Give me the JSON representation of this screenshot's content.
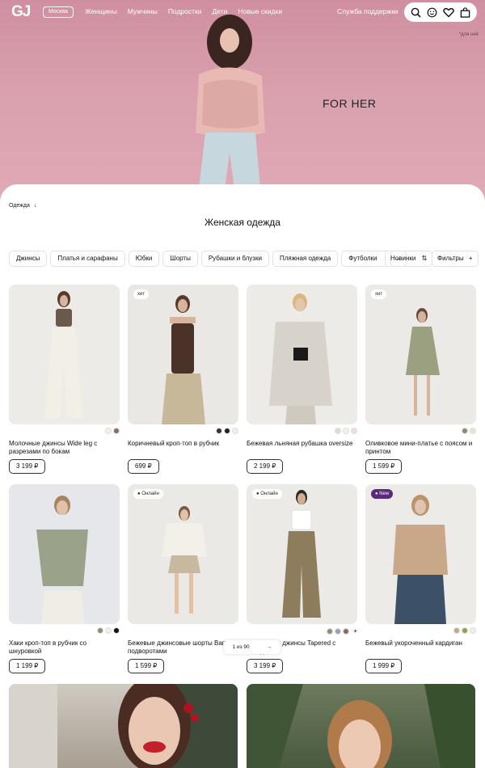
{
  "brand": {
    "logo": "GJ",
    "city": "Москва"
  },
  "nav": {
    "items": [
      "Женщины",
      "Мужчины",
      "Подростки",
      "Дети",
      "Новые скидки"
    ],
    "support": "Служба поддержки"
  },
  "icons": [
    "search-icon",
    "smiley-icon",
    "heart-icon",
    "bag-icon"
  ],
  "hero": {
    "title": "FOR HER",
    "note": "*для неё"
  },
  "breadcrumb": {
    "label": "Одежда",
    "arrow": "↓"
  },
  "page": {
    "title": "Женская одежда"
  },
  "categories": [
    "Джинсы",
    "Платья и сарафаны",
    "Юбки",
    "Шорты",
    "Рубашки и блузки",
    "Пляжная одежда",
    "Футболки"
  ],
  "categories_more": "→",
  "sort": {
    "label": "Новинки",
    "icon": "⇅"
  },
  "filters": {
    "label": "Фильтры",
    "icon": "+"
  },
  "products": [
    {
      "name": "Молочные джинсы Wide leg с разрезами по бокам",
      "price": "3 199 ₽",
      "badge": "",
      "swatches": [
        "#f2f0ea",
        "#8b6c5c"
      ]
    },
    {
      "name": "Коричневый кроп-топ в рубчик",
      "price": "699 ₽",
      "badge": "хит",
      "swatches": [
        "#4a2d28",
        "#222222",
        "#eeeeee"
      ]
    },
    {
      "name": "Бежевая льняная рубашка oversize",
      "price": "2 199 ₽",
      "badge": "",
      "swatches": [
        "#dedcd6",
        "#f4f1ea",
        "#f1d9dc"
      ]
    },
    {
      "name": "Оливковое мини-платье с поясом и принтом",
      "price": "1 599 ₽",
      "badge": "хит",
      "swatches": [
        "#8c8d6e",
        "#e4e2dc"
      ]
    },
    {
      "name": "Хаки кроп-топ в рубчик со шнуровкой",
      "price": "1 199 ₽",
      "badge": "",
      "swatches": [
        "#8a8f72",
        "#f3f1ec",
        "#111111"
      ]
    },
    {
      "name": "Бежевые джинсовые шорты Вагги с подворотами",
      "price": "1 599 ₽",
      "badge": "● Онлайн",
      "swatches": []
    },
    {
      "name": "Оливковые джинсы Tapered с посадкой",
      "price": "3 199 ₽",
      "badge": "● Онлайн",
      "swatches": [
        "#8a8f72",
        "#9aa3a8",
        "#8b6c5c"
      ],
      "more": "+"
    },
    {
      "name": "Бежевый укороченный кардиган",
      "price": "1 999 ₽",
      "badge": "● New",
      "swatches": [
        "#c9a38c",
        "#8fa14a",
        "#eeeeee"
      ]
    }
  ],
  "pager": {
    "label": "1 из 90",
    "next": "→"
  },
  "colors": {
    "hero_pink": "#d49aa8",
    "new_badge": "#5a2b7a",
    "text": "#111111"
  }
}
